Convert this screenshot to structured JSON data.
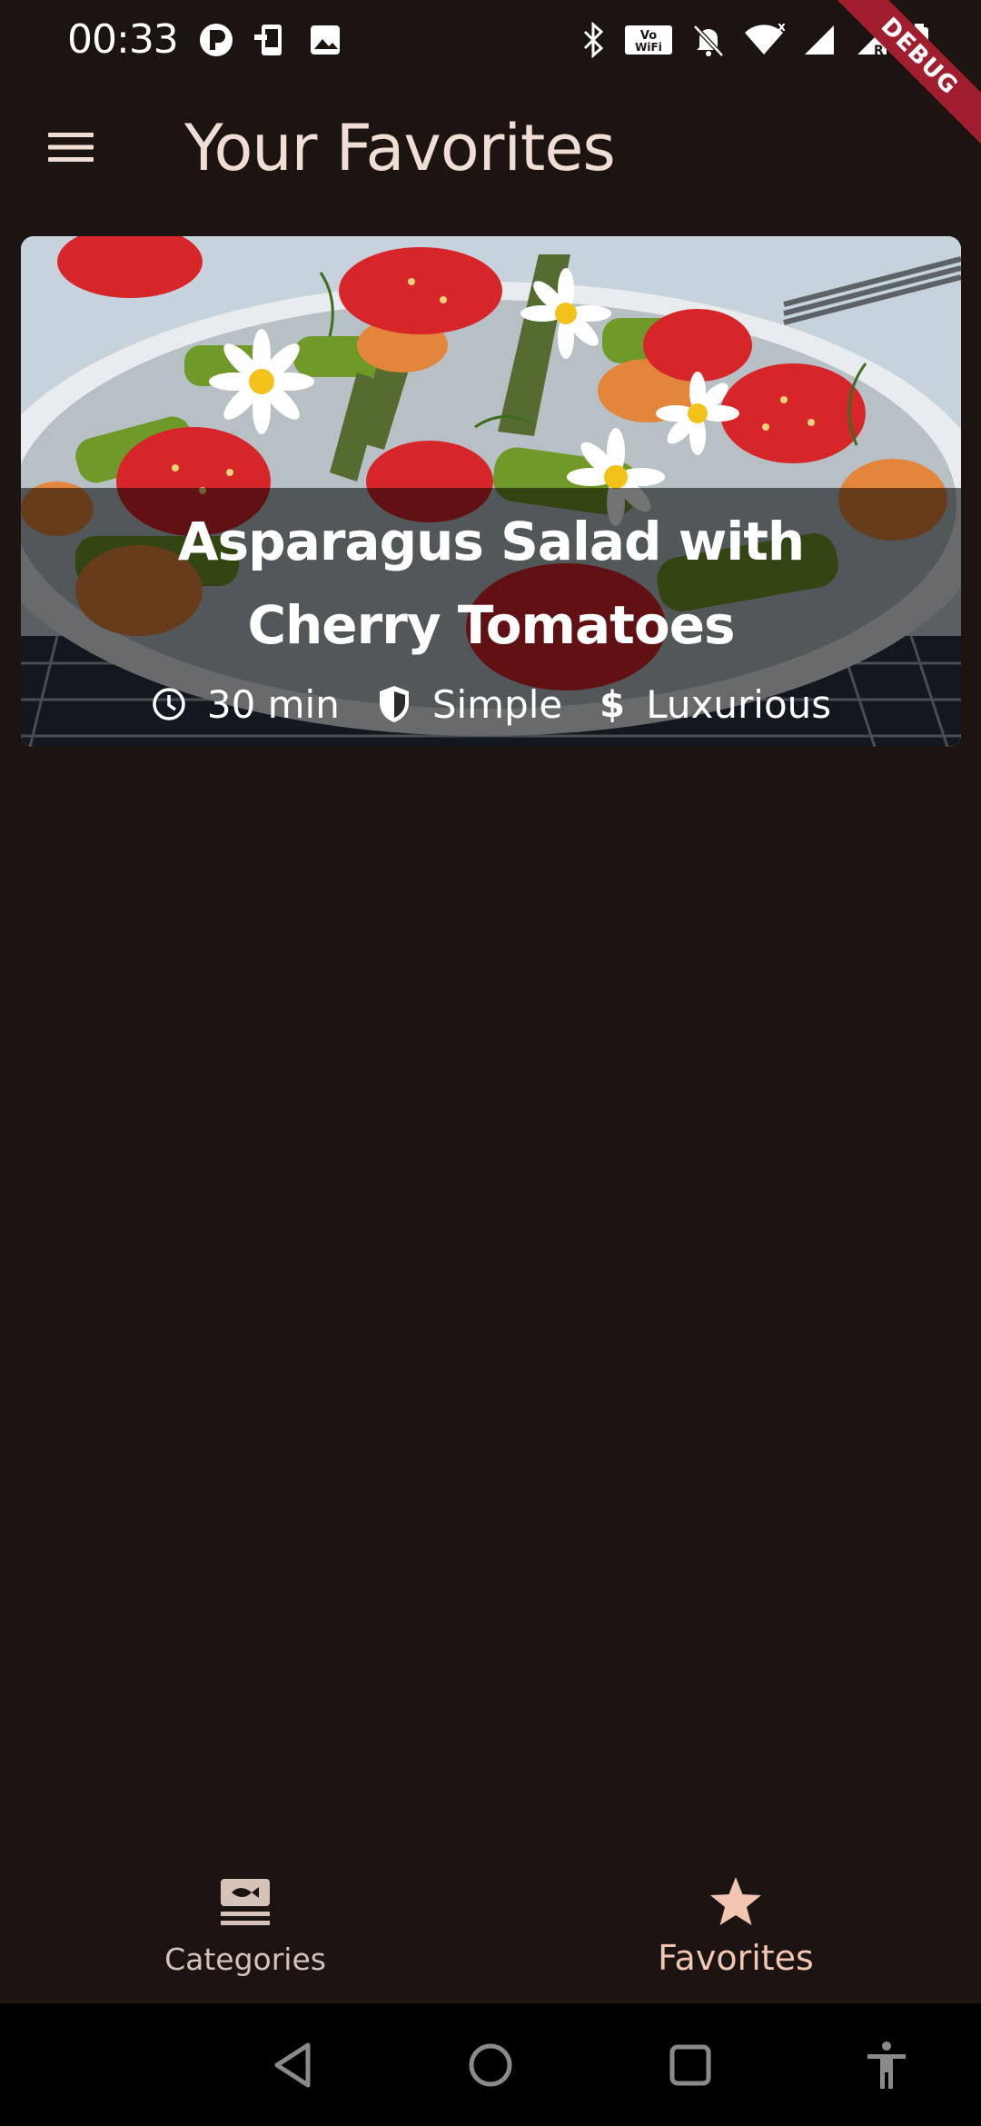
{
  "status_bar": {
    "time": "00:33",
    "left_icons": [
      "dnd-app-icon",
      "phone-download-icon",
      "image-icon"
    ],
    "right_icons": [
      "bluetooth-icon",
      "vowifi-icon",
      "bell-off-icon",
      "wifi-icon",
      "signal-icon",
      "signal-roaming-icon",
      "battery-icon"
    ],
    "debug_label": "DEBUG"
  },
  "app_bar": {
    "title": "Your Favorites",
    "menu_icon": "menu-icon"
  },
  "favorites": [
    {
      "title": "Asparagus Salad with Cherry Tomatoes",
      "duration": "30 min",
      "complexity": "Simple",
      "affordability": "Luxurious"
    }
  ],
  "bottom_nav": {
    "items": [
      {
        "label": "Categories",
        "icon": "set-meal-icon",
        "active": false
      },
      {
        "label": "Favorites",
        "icon": "star-icon",
        "active": true
      }
    ]
  },
  "system_nav": {
    "buttons": [
      "back-icon",
      "home-icon",
      "recents-icon",
      "accessibility-icon"
    ]
  },
  "colors": {
    "background": "#1b1411",
    "title_text": "#f0ddd3",
    "active_nav": "#f2c6b0",
    "inactive_nav": "#d5c3ba",
    "debug_banner": "#a01e2e"
  }
}
